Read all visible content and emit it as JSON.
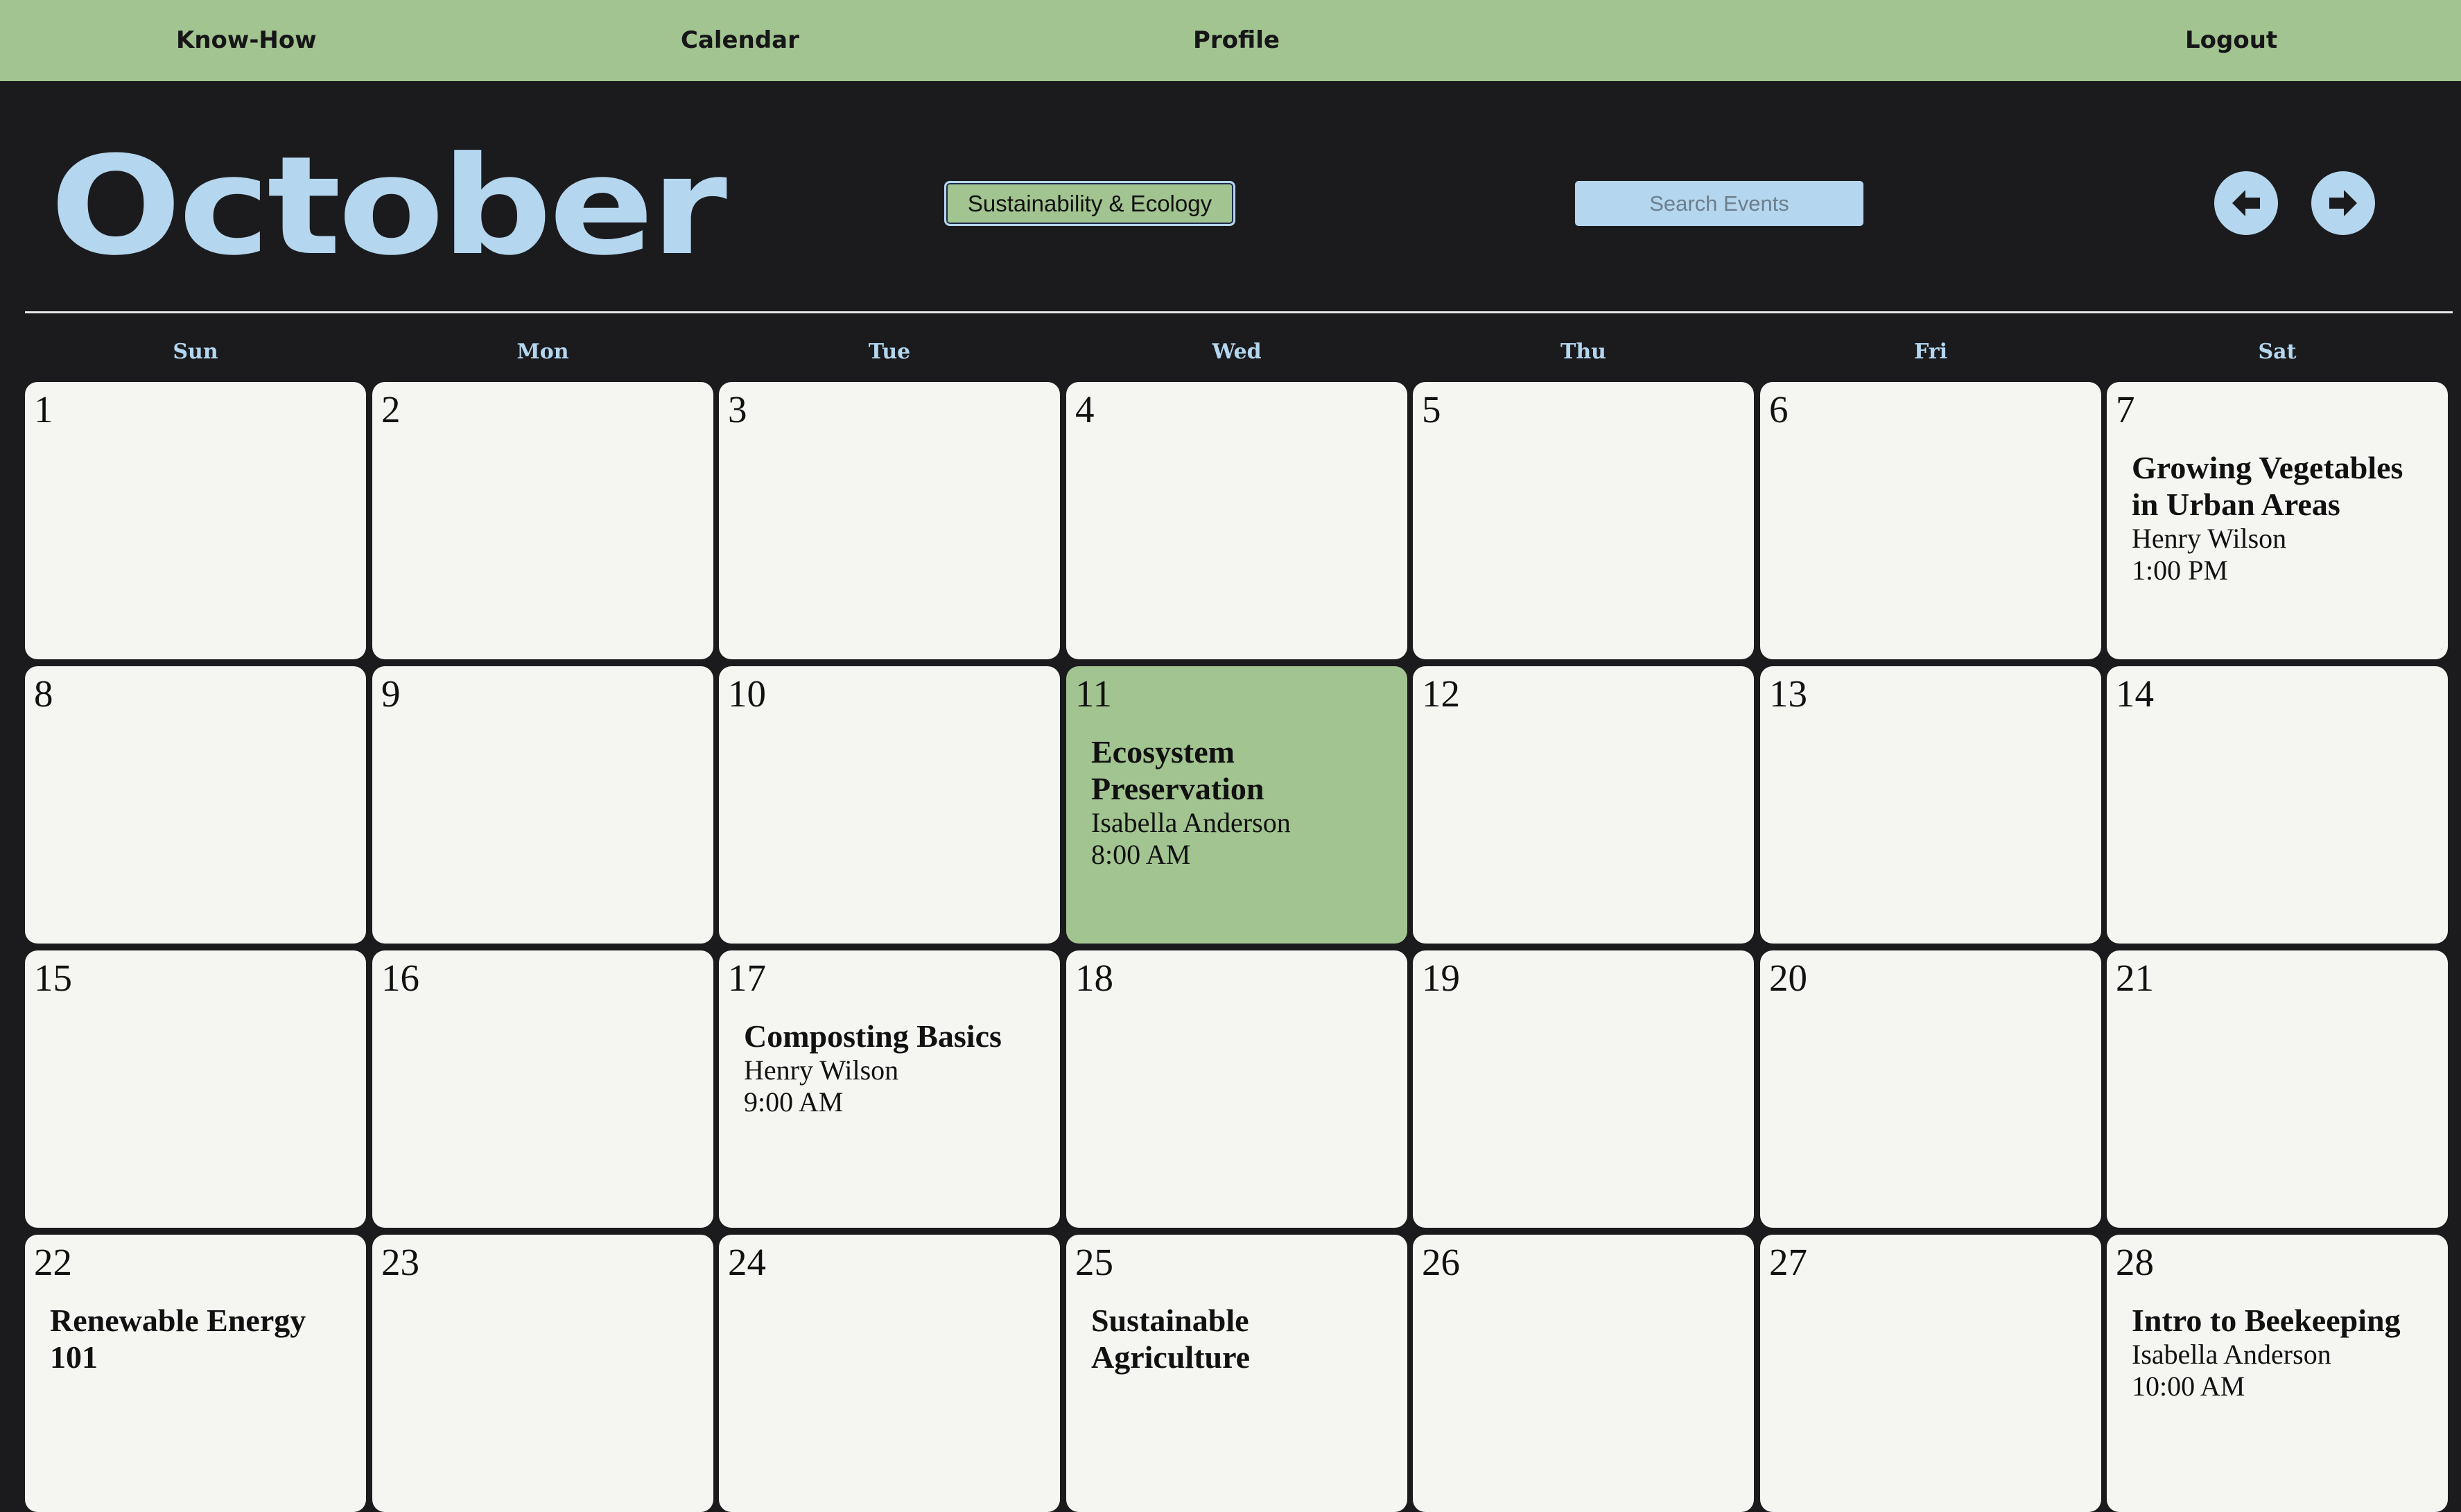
{
  "nav": {
    "knowhow": "Know-How",
    "calendar": "Calendar",
    "profile": "Profile",
    "logout": "Logout"
  },
  "header": {
    "month": "October",
    "category_selected": "Sustainability & Ecology",
    "search_placeholder": "Search Events",
    "prev_icon": "arrow-left-circle-icon",
    "next_icon": "arrow-right-circle-icon"
  },
  "weekdays": [
    "Sun",
    "Mon",
    "Tue",
    "Wed",
    "Thu",
    "Fri",
    "Sat"
  ],
  "days": [
    {
      "num": "1"
    },
    {
      "num": "2"
    },
    {
      "num": "3"
    },
    {
      "num": "4"
    },
    {
      "num": "5"
    },
    {
      "num": "6"
    },
    {
      "num": "7",
      "event": {
        "title": "Growing Vegetables in Urban Areas",
        "host": "Henry Wilson",
        "time": "1:00 PM"
      }
    },
    {
      "num": "8"
    },
    {
      "num": "9"
    },
    {
      "num": "10"
    },
    {
      "num": "11",
      "highlighted": true,
      "event": {
        "title": "Ecosystem Preservation",
        "host": "Isabella Anderson",
        "time": "8:00 AM"
      }
    },
    {
      "num": "12"
    },
    {
      "num": "13"
    },
    {
      "num": "14"
    },
    {
      "num": "15"
    },
    {
      "num": "16"
    },
    {
      "num": "17",
      "event": {
        "title": "Composting Basics",
        "host": "Henry Wilson",
        "time": "9:00 AM"
      }
    },
    {
      "num": "18"
    },
    {
      "num": "19"
    },
    {
      "num": "20"
    },
    {
      "num": "21"
    },
    {
      "num": "22",
      "event": {
        "title": "Renewable Energy 101",
        "host": "",
        "time": ""
      }
    },
    {
      "num": "23"
    },
    {
      "num": "24"
    },
    {
      "num": "25",
      "event": {
        "title": "Sustainable Agriculture",
        "host": "",
        "time": ""
      }
    },
    {
      "num": "26"
    },
    {
      "num": "27"
    },
    {
      "num": "28",
      "event": {
        "title": "Intro to Beekeeping",
        "host": "Isabella Anderson",
        "time": "10:00 AM"
      }
    }
  ],
  "colors": {
    "background": "#1b1b1e",
    "accent_green": "#a2c490",
    "accent_blue": "#b4d6ee",
    "cell": "#f5f5f2"
  }
}
